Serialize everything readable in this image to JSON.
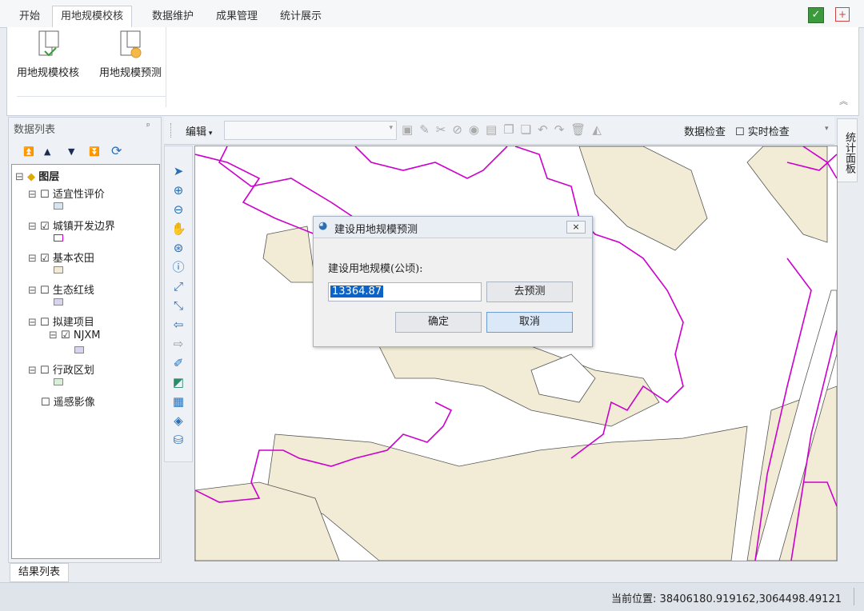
{
  "ribbon": {
    "tabs": [
      "开始",
      "用地规模校核",
      "数据维护",
      "成果管理",
      "统计展示"
    ],
    "buttons": [
      "用地规模校核",
      "用地规模预测"
    ]
  },
  "left_panel": {
    "title": "数据列表",
    "pin": "ᵖ",
    "root": "图层",
    "layers": [
      {
        "label": "适宜性评价",
        "checked": false
      },
      {
        "label": "城镇开发边界",
        "checked": true
      },
      {
        "label": "基本农田",
        "checked": true
      },
      {
        "label": "生态红线",
        "checked": false
      },
      {
        "label": "拟建项目",
        "checked": false
      },
      {
        "label": "NJXM",
        "checked": true
      },
      {
        "label": "行政区划",
        "checked": false
      },
      {
        "label": "遥感影像",
        "checked": false
      }
    ],
    "check_on": "☑",
    "check_off": "☐",
    "expand": "⊟"
  },
  "edit_toolbar": {
    "edit_label": "编辑",
    "data_check": "数据检查",
    "realtime_check": "实时检查"
  },
  "side_tab": "统计面板",
  "dialog": {
    "title": "建设用地规模预测",
    "field_label": "建设用地规模(公顷):",
    "value": "13364.87",
    "predict_button": "去预测",
    "ok_button": "确定",
    "cancel_button": "取消",
    "close": "×"
  },
  "bottom": {
    "result_tab": "结果列表",
    "status": "当前位置: 38406180.919162,3064498.49121"
  },
  "colors": {
    "farmland": "#f2ecd6",
    "boundary": "#cc00cc",
    "accent": "#2a6fb3"
  }
}
